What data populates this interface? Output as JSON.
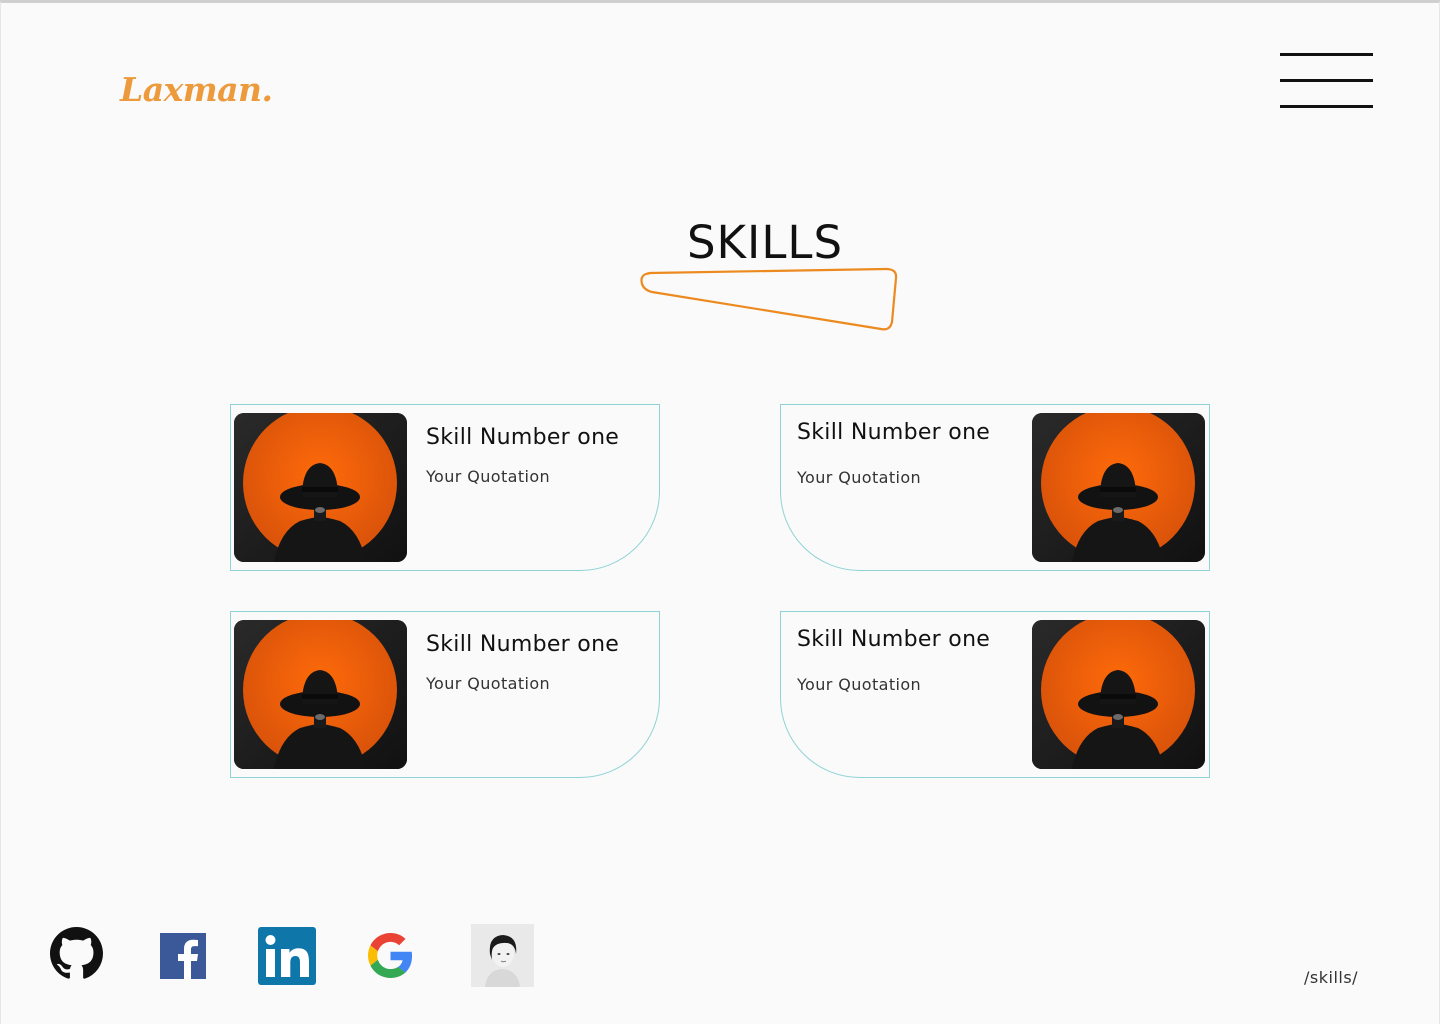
{
  "header": {
    "logo_text": "Laxman.",
    "menu_icon": "hamburger-menu-icon"
  },
  "main": {
    "title": "SKILLS",
    "accent_color": "#ec8a1f",
    "card_border_color": "#8fd3d6",
    "cards": [
      {
        "title": "Skill Number one",
        "quotation": "Your Quotation",
        "image": "woman-in-hat-orange-circle-image"
      },
      {
        "title": "Skill Number one",
        "quotation": "Your Quotation",
        "image": "woman-in-hat-orange-circle-image"
      },
      {
        "title": "Skill Number one",
        "quotation": "Your Quotation",
        "image": "woman-in-hat-orange-circle-image"
      },
      {
        "title": "Skill Number one",
        "quotation": "Your Quotation",
        "image": "woman-in-hat-orange-circle-image"
      }
    ]
  },
  "footer": {
    "social": [
      {
        "name": "github",
        "icon": "github-icon"
      },
      {
        "name": "facebook",
        "icon": "facebook-icon"
      },
      {
        "name": "linkedin",
        "icon": "linkedin-icon"
      },
      {
        "name": "google",
        "icon": "google-icon"
      },
      {
        "name": "profile",
        "icon": "profile-photo"
      }
    ],
    "path": "/skills/"
  }
}
